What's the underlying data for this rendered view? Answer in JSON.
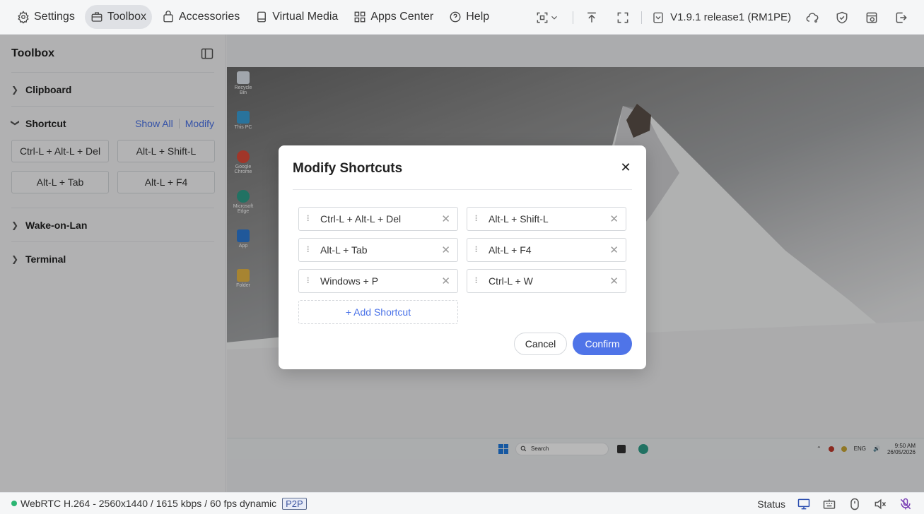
{
  "nav": {
    "items": [
      {
        "label": "Settings",
        "icon": "gear-icon"
      },
      {
        "label": "Toolbox",
        "icon": "toolbox-icon"
      },
      {
        "label": "Accessories",
        "icon": "bag-icon"
      },
      {
        "label": "Virtual Media",
        "icon": "drive-icon"
      },
      {
        "label": "Apps Center",
        "icon": "apps-icon"
      },
      {
        "label": "Help",
        "icon": "help-icon"
      }
    ],
    "version": "V1.9.1 release1 (RM1PE)"
  },
  "sidebar": {
    "title": "Toolbox",
    "sections": {
      "clipboard": "Clipboard",
      "shortcut": "Shortcut",
      "show_all": "Show All",
      "modify": "Modify",
      "wake": "Wake-on-Lan",
      "terminal": "Terminal"
    },
    "shortcuts": [
      "Ctrl-L + Alt-L + Del",
      "Alt-L + Shift-L",
      "Alt-L + Tab",
      "Alt-L + F4"
    ]
  },
  "remote": {
    "desktop_icons": [
      "Recycle Bin",
      "This PC",
      "Google Chrome",
      "Microsoft Edge",
      "App",
      "Folder"
    ],
    "taskbar": {
      "search": "Search",
      "lang": "ENG",
      "time": "9:50 AM",
      "date": "26/05/2026"
    }
  },
  "dialog": {
    "title": "Modify Shortcuts",
    "shortcuts": [
      "Ctrl-L + Alt-L + Del",
      "Alt-L + Shift-L",
      "Alt-L + Tab",
      "Alt-L + F4",
      "Windows + P",
      "Ctrl-L + W"
    ],
    "add_label": "+ Add Shortcut",
    "cancel": "Cancel",
    "confirm": "Confirm"
  },
  "status": {
    "stream": "WebRTC H.264 - 2560x1440 / 1615 kbps / 60 fps dynamic",
    "mode": "P2P",
    "status_label": "Status"
  },
  "colors": {
    "accent": "#4f74e8",
    "online": "#2bb673"
  }
}
